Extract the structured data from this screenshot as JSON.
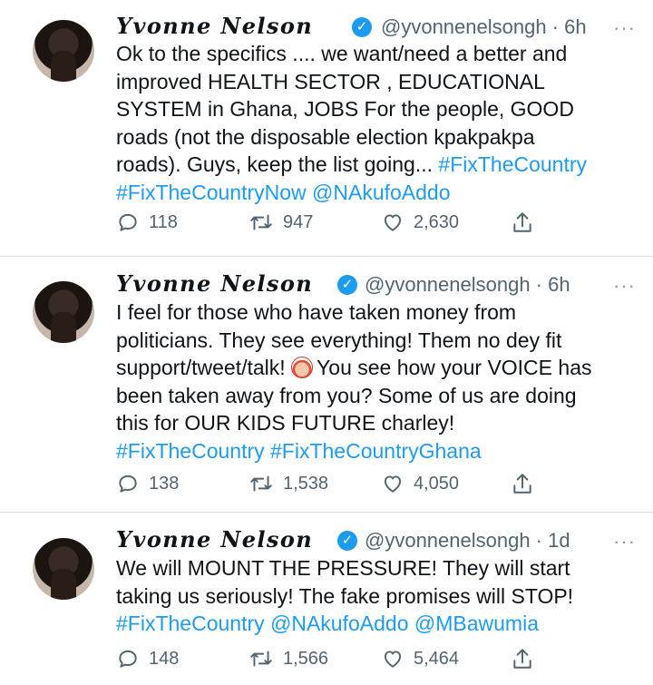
{
  "tweets": [
    {
      "author_name": "Yvonne Nelson",
      "handle_time": "@yvonnenelsongh · 6h",
      "lines": [
        {
          "text": "Ok to the specifics .... we want/need a better and"
        },
        {
          "text": "improved HEALTH SECTOR , EDUCATIONAL"
        },
        {
          "text": "SYSTEM in Ghana, JOBS For the people, GOOD"
        },
        {
          "text": "roads (not the disposable election kpakpakpa"
        },
        {
          "text": "roads). Guys, keep the list going... ",
          "link": "#FixTheCountry"
        },
        {
          "link": "#FixTheCountryNow @NAkufoAddo"
        }
      ],
      "replies": "118",
      "retweets": "947",
      "likes": "2,630"
    },
    {
      "author_name": "Yvonne Nelson",
      "handle_time": "@yvonnenelsongh · 6h",
      "lines": [
        {
          "text": "I feel for those who have taken money from"
        },
        {
          "text": "politicians. They see everything! Them no dey fit"
        },
        {
          "text": "support/tweet/talk! ",
          "text2": "You see how your VOICE has"
        },
        {
          "text": "been taken away from you? Some of us are doing"
        },
        {
          "text": "this for OUR KIDS FUTURE charley!"
        },
        {
          "link": "#FixTheCountry #FixTheCountryGhana"
        }
      ],
      "emoji": "clown-face-emoji",
      "replies": "138",
      "retweets": "1,538",
      "likes": "4,050"
    },
    {
      "author_name": "Yvonne Nelson",
      "handle_time": "@yvonnenelsongh · 1d",
      "lines": [
        {
          "text": "We will MOUNT THE PRESSURE! They will start"
        },
        {
          "text": "taking us seriously! The fake promises will STOP!"
        },
        {
          "link": "#FixTheCountry @NAkufoAddo @MBawumia"
        }
      ],
      "replies": "148",
      "retweets": "1,566",
      "likes": "5,464"
    }
  ],
  "more_glyph": "···",
  "verified_glyph": "✓",
  "icons": {
    "reply": "reply-icon",
    "retweet": "retweet-icon",
    "like": "heart-icon",
    "share": "share-icon"
  },
  "colors": {
    "link": "#1d9bf0",
    "verified": "#1d9bf0",
    "muted": "#536471",
    "divider": "#d8dde2"
  }
}
